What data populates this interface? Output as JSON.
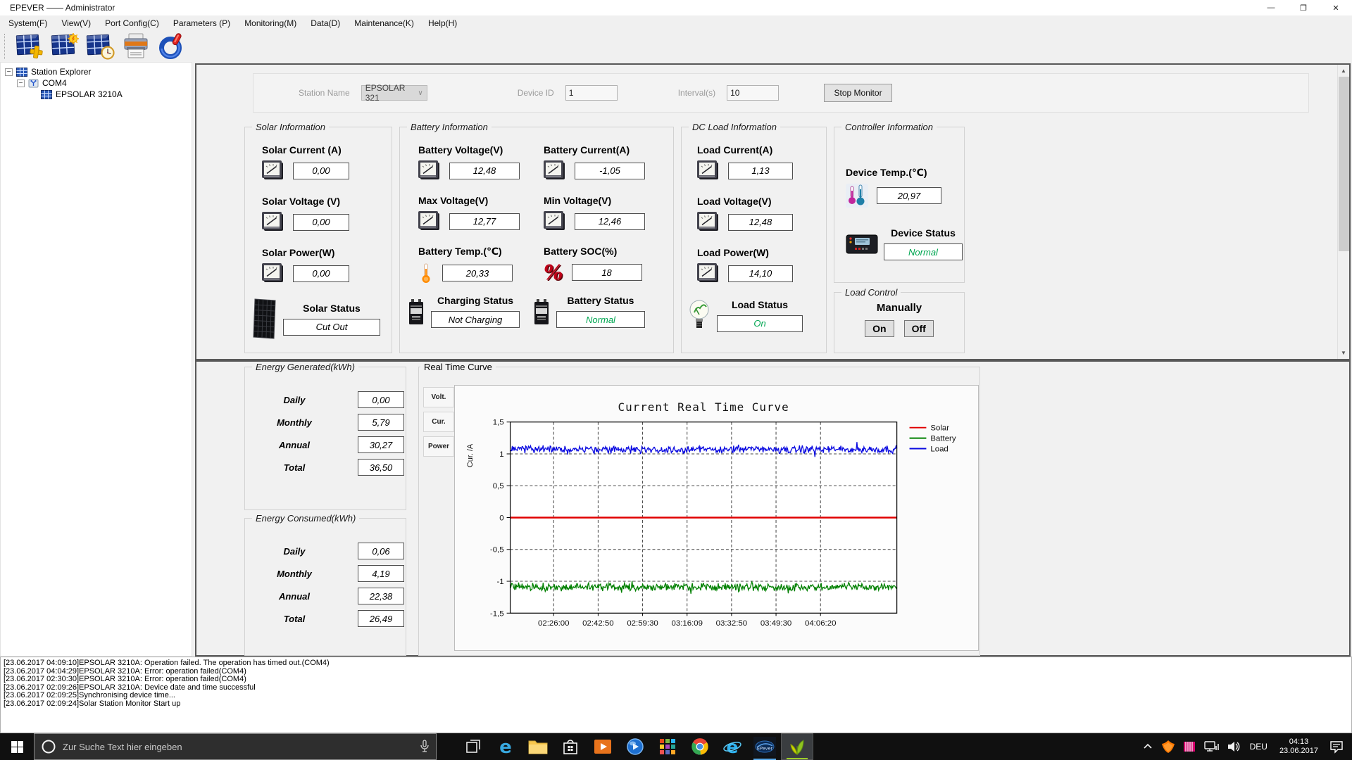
{
  "window": {
    "title": "EPEVER —— Administrator",
    "controls": {
      "minimize": "—",
      "restore": "❐",
      "close": "✕"
    }
  },
  "menu": {
    "items": [
      "System(F)",
      "View(V)",
      "Port Config(C)",
      "Parameters (P)",
      "Monitoring(M)",
      "Data(D)",
      "Maintenance(K)",
      "Help(H)"
    ]
  },
  "toolbar": {
    "buttons": [
      {
        "name": "add-station-button",
        "icon": "solar-panel-plus-icon"
      },
      {
        "name": "station-monitor-button",
        "icon": "solar-panel-sun-icon"
      },
      {
        "name": "history-data-button",
        "icon": "solar-panel-clock-icon"
      },
      {
        "name": "print-button",
        "icon": "printer-icon"
      },
      {
        "name": "exit-button",
        "icon": "power-icon"
      }
    ]
  },
  "tree": {
    "items": [
      {
        "label": "Station Explorer",
        "level": 0,
        "expander": true,
        "icon": "tree-solar-icon"
      },
      {
        "label": "COM4",
        "level": 1,
        "expander": true,
        "icon": "com-port-icon"
      },
      {
        "label": "EPSOLAR 3210A",
        "level": 2,
        "expander": false,
        "icon": "tree-solar-icon"
      }
    ]
  },
  "monitor_form": {
    "station_name_label": "Station Name",
    "station_name_value": "EPSOLAR 321",
    "device_id_label": "Device ID",
    "device_id_value": "1",
    "interval_label": "Interval(s)",
    "interval_value": "10",
    "stop_button_label": "Stop Monitor"
  },
  "panels": {
    "solar": {
      "title": "Solar Information",
      "fields": [
        {
          "id": "solar-current",
          "label": "Solar Current (A)",
          "value": "0,00",
          "icon": "meter-icon"
        },
        {
          "id": "solar-voltage",
          "label": "Solar Voltage (V)",
          "value": "0,00",
          "icon": "meter-icon"
        },
        {
          "id": "solar-power",
          "label": "Solar Power(W)",
          "value": "0,00",
          "icon": "meter-icon"
        }
      ],
      "statuses": [
        {
          "id": "solar-status",
          "label": "Solar Status",
          "value": "Cut Out",
          "icon": "solar-panel-large-icon",
          "color": "#000000"
        }
      ]
    },
    "battery": {
      "title": "Battery Information",
      "fields": [
        {
          "id": "battery-voltage",
          "label": "Battery Voltage(V)",
          "value": "12,48",
          "icon": "meter-icon"
        },
        {
          "id": "battery-current",
          "label": "Battery Current(A)",
          "value": "-1,05",
          "icon": "meter-icon"
        },
        {
          "id": "max-voltage",
          "label": "Max Voltage(V)",
          "value": "12,77",
          "icon": "meter-icon"
        },
        {
          "id": "min-voltage",
          "label": "Min Voltage(V)",
          "value": "12,46",
          "icon": "meter-icon"
        },
        {
          "id": "battery-temp",
          "label": "Battery Temp.(℃)",
          "value": "20,33",
          "icon": "thermometer-icon"
        },
        {
          "id": "battery-soc",
          "label": "Battery SOC(%)",
          "value": "18",
          "icon": "percent-icon"
        }
      ],
      "statuses": [
        {
          "id": "charging-status",
          "label": "Charging Status",
          "value": "Not Charging",
          "icon": "battery-icon",
          "color": "#000000"
        },
        {
          "id": "battery-status",
          "label": "Battery Status",
          "value": "Normal",
          "icon": "battery-icon",
          "color": "#00a651"
        }
      ]
    },
    "dc_load": {
      "title": "DC Load Information",
      "fields": [
        {
          "id": "load-current",
          "label": "Load Current(A)",
          "value": "1,13",
          "icon": "meter-icon"
        },
        {
          "id": "load-voltage",
          "label": "Load Voltage(V)",
          "value": "12,48",
          "icon": "meter-icon"
        },
        {
          "id": "load-power",
          "label": "Load Power(W)",
          "value": "14,10",
          "icon": "meter-icon"
        }
      ],
      "statuses": [
        {
          "id": "load-status",
          "label": "Load Status",
          "value": "On",
          "icon": "bulb-icon",
          "color": "#00a651"
        }
      ]
    },
    "controller": {
      "title": "Controller Information",
      "fields": [
        {
          "id": "device-temp",
          "label": "Device Temp.(℃)",
          "value": "20,97",
          "icon": "dual-thermometer-icon"
        }
      ],
      "statuses": [
        {
          "id": "device-status",
          "label": "Device Status",
          "value": "Normal",
          "icon": "controller-icon",
          "color": "#00a651"
        }
      ]
    },
    "load_control": {
      "title": "Load Control",
      "subtitle": "Manually",
      "on_label": "On",
      "off_label": "Off"
    },
    "energy_generated": {
      "title": "Energy Generated(kWh)",
      "rows": [
        [
          "Daily",
          "0,00"
        ],
        [
          "Monthly",
          "5,79"
        ],
        [
          "Annual",
          "30,27"
        ],
        [
          "Total",
          "36,50"
        ]
      ]
    },
    "energy_consumed": {
      "title": "Energy Consumed(kWh)",
      "rows": [
        [
          "Daily",
          "0,06"
        ],
        [
          "Monthly",
          "4,19"
        ],
        [
          "Annual",
          "22,38"
        ],
        [
          "Total",
          "26,49"
        ]
      ]
    },
    "real_time_curve": {
      "title": "Real Time Curve",
      "tabs": [
        "Volt.",
        "Cur.",
        "Power"
      ]
    }
  },
  "chart_data": {
    "type": "line",
    "title": "Current Real Time Curve",
    "ylabel": "Cur. /A",
    "xlabel": "",
    "ylim": [
      -1.5,
      1.5
    ],
    "y_ticks": [
      1.5,
      1,
      0.5,
      0,
      -0.5,
      -1,
      -1.5
    ],
    "y_tick_labels": [
      "1,5",
      "1",
      "0,5",
      "0",
      "-0,5",
      "-1",
      "-1,5"
    ],
    "x_tick_labels": [
      "02:26:00",
      "02:42:50",
      "02:59:30",
      "03:16:09",
      "03:32:50",
      "03:49:30",
      "04:06:20"
    ],
    "grid": "dashed",
    "legend_position": "right",
    "series": [
      {
        "name": "Solar",
        "color": "#e00000",
        "mean": 0.0,
        "noise_amplitude": 0.0
      },
      {
        "name": "Battery",
        "color": "#008000",
        "mean": -1.09,
        "noise_amplitude": 0.06
      },
      {
        "name": "Load",
        "color": "#0a0ae0",
        "mean": 1.07,
        "noise_amplitude": 0.06
      }
    ]
  },
  "log": {
    "entries": [
      "[23.06.2017 04:09:10]EPSOLAR 3210A: Operation failed. The operation has timed out.(COM4)",
      "[23.06.2017 04:04:29]EPSOLAR 3210A: Error: operation failed(COM4)",
      "[23.06.2017 02:30:30]EPSOLAR 3210A: Error: operation failed(COM4)",
      "[23.06.2017 02:09:26]EPSOLAR 3210A: Device date and time successful",
      "[23.06.2017 02:09:25]Synchronising device time...",
      "[23.06.2017 02:09:24]Solar Station Monitor Start up"
    ]
  },
  "taskbar": {
    "search_placeholder": "Zur Suche Text hier eingeben",
    "language": "DEU",
    "time": "04:13",
    "date": "23.06.2017",
    "apps": [
      {
        "name": "taskbar-task-view",
        "icon": "task-view-icon"
      },
      {
        "name": "taskbar-edge",
        "icon": "edge-icon"
      },
      {
        "name": "taskbar-file-explorer",
        "icon": "folder-icon"
      },
      {
        "name": "taskbar-store",
        "icon": "store-icon"
      },
      {
        "name": "taskbar-video-app",
        "icon": "video-app-icon"
      },
      {
        "name": "taskbar-media-app",
        "icon": "media-app-icon"
      },
      {
        "name": "taskbar-apps-hub",
        "icon": "apps-grid-icon"
      },
      {
        "name": "taskbar-chrome",
        "icon": "chrome-icon"
      },
      {
        "name": "taskbar-ie",
        "icon": "ie-icon"
      },
      {
        "name": "taskbar-epever",
        "icon": "epever-app-icon",
        "indicator": "#57a8e8"
      },
      {
        "name": "taskbar-solar-monitor",
        "icon": "leaf-app-icon",
        "indicator": "#9ccd2a",
        "highlight": true
      }
    ],
    "tray": [
      {
        "name": "tray-chevron",
        "icon": "chevron-up-icon"
      },
      {
        "name": "tray-antivirus",
        "icon": "antivirus-icon"
      },
      {
        "name": "tray-app",
        "icon": "pink-app-icon"
      },
      {
        "name": "tray-network",
        "icon": "network-icon"
      },
      {
        "name": "tray-volume",
        "icon": "volume-icon"
      }
    ]
  }
}
